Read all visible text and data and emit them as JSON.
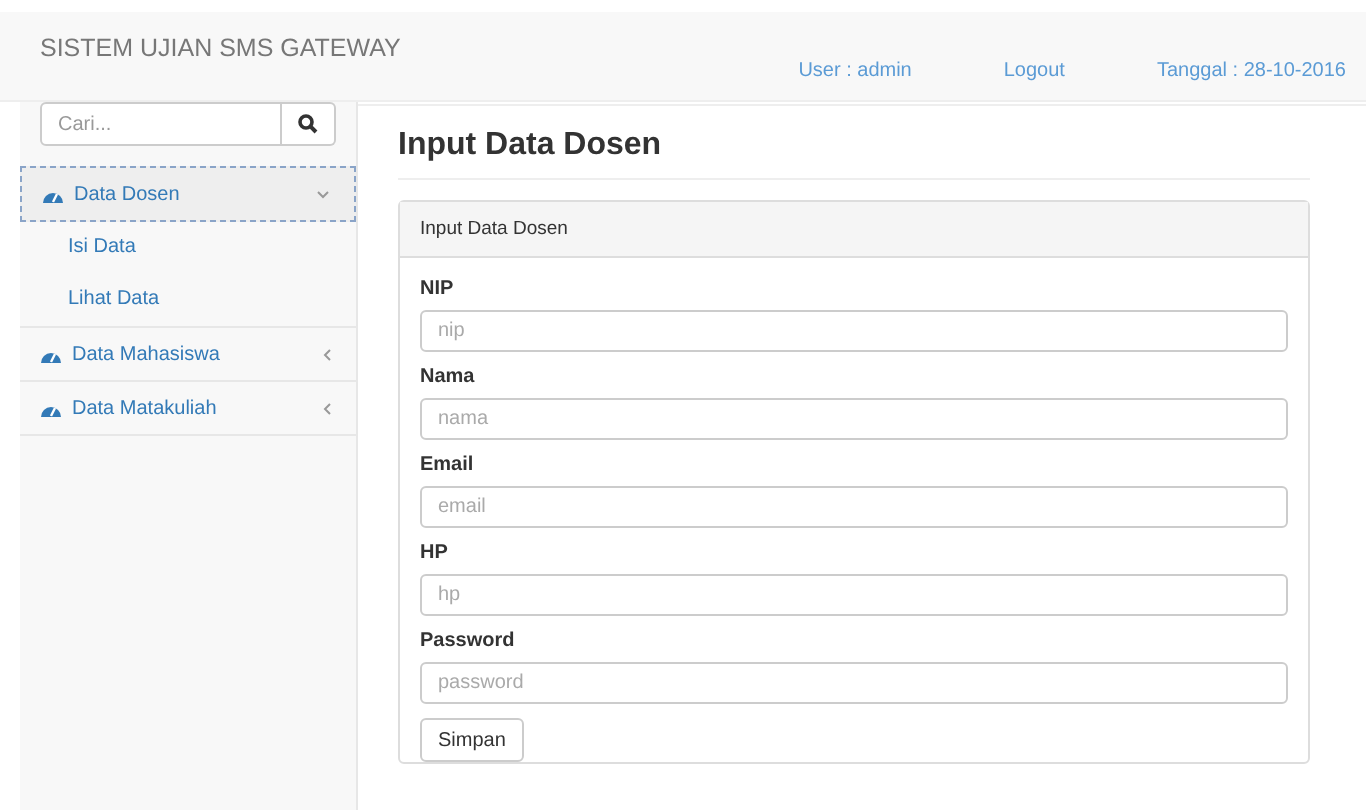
{
  "header": {
    "brand": "SISTEM UJIAN SMS GATEWAY",
    "user": "User : admin",
    "logout": "Logout",
    "date": "Tanggal : 28-10-2016"
  },
  "search": {
    "placeholder": "Cari..."
  },
  "sidebar": {
    "items": [
      {
        "label": "Data Dosen",
        "selected": true,
        "expanded": true,
        "children": [
          {
            "label": "Isi Data"
          },
          {
            "label": "Lihat Data"
          }
        ]
      },
      {
        "label": "Data Mahasiswa",
        "selected": false,
        "expanded": false
      },
      {
        "label": "Data Matakuliah",
        "selected": false,
        "expanded": false
      }
    ]
  },
  "page": {
    "title": "Input Data Dosen",
    "panel_title": "Input Data Dosen",
    "fields": [
      {
        "label": "NIP",
        "placeholder": "nip"
      },
      {
        "label": "Nama",
        "placeholder": "nama"
      },
      {
        "label": "Email",
        "placeholder": "email"
      },
      {
        "label": "HP",
        "placeholder": "hp"
      },
      {
        "label": "Password",
        "placeholder": "password"
      }
    ],
    "submit": "Simpan"
  }
}
